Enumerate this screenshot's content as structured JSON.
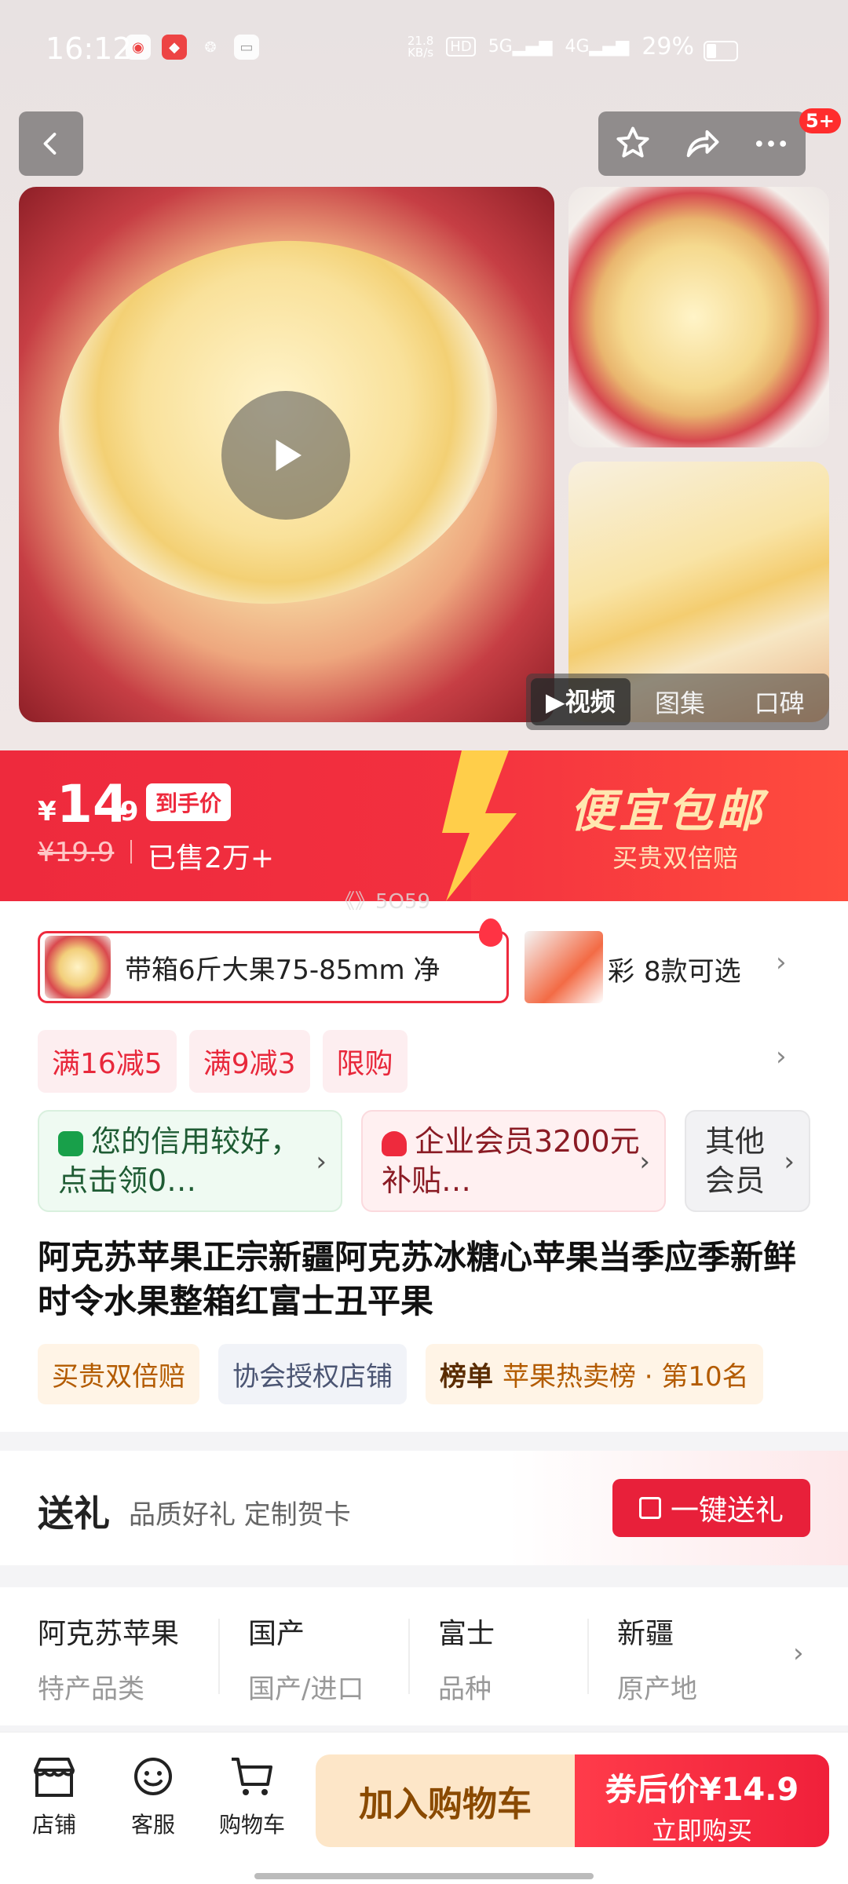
{
  "status": {
    "time": "16:12",
    "net_speed": "21.8\nKB/s",
    "hd": "HD",
    "signal_5g": "5G",
    "signal_4g": "4G",
    "battery": "29%"
  },
  "nav": {
    "badge": "5+"
  },
  "media_tabs": [
    {
      "label": "▶视频"
    },
    {
      "label": "图集"
    },
    {
      "label": "口碑"
    }
  ],
  "price": {
    "yen": "¥",
    "int": "14",
    "dec": ".9",
    "tag": "到手价",
    "old": "¥19.9",
    "sold": "已售2万+",
    "promo_title": "便宜包邮",
    "promo_sub": "买贵双倍赔",
    "ticker": "《》5O59"
  },
  "sku": {
    "selected": "带箱6斤大果75-85mm 净",
    "second_initial": "彩",
    "more": "8款可选"
  },
  "coupons": [
    "满16减5",
    "满9减3",
    "限购"
  ],
  "members": {
    "credit": "您的信用较好，点击领0…",
    "enterprise": "企业会员3200元补贴…",
    "other": "其他会员"
  },
  "product_title": "阿克苏苹果正宗新疆阿克苏冰糖心苹果当季应季新鲜时令水果整箱红富士丑平果",
  "tags": {
    "t1": "买贵双倍赔",
    "t2": "协会授权店铺",
    "t3_bold": "榜单",
    "t3": "苹果热卖榜 · 第10名"
  },
  "gift": {
    "title": "送礼",
    "sub": "品质好礼 定制贺卡",
    "button": "一键送礼"
  },
  "specs": [
    {
      "value": "阿克苏苹果",
      "key": "特产品类"
    },
    {
      "value": "国产",
      "key": "国产/进口"
    },
    {
      "value": "富士",
      "key": "品种"
    },
    {
      "value": "新疆",
      "key": "原产地"
    }
  ],
  "bottom": {
    "shop": "店铺",
    "service": "客服",
    "cart": "购物车",
    "add_cart": "加入购物车",
    "buy_top": "券后价¥14.9",
    "buy_bottom": "立即购买"
  },
  "colors": {
    "accent": "#ee2a3d",
    "promo": "#ffe7b0"
  },
  "icons": [
    "back-icon",
    "star-icon",
    "share-icon",
    "more-icon",
    "play-icon",
    "shop-icon",
    "service-icon",
    "cart-icon",
    "gift-icon"
  ]
}
